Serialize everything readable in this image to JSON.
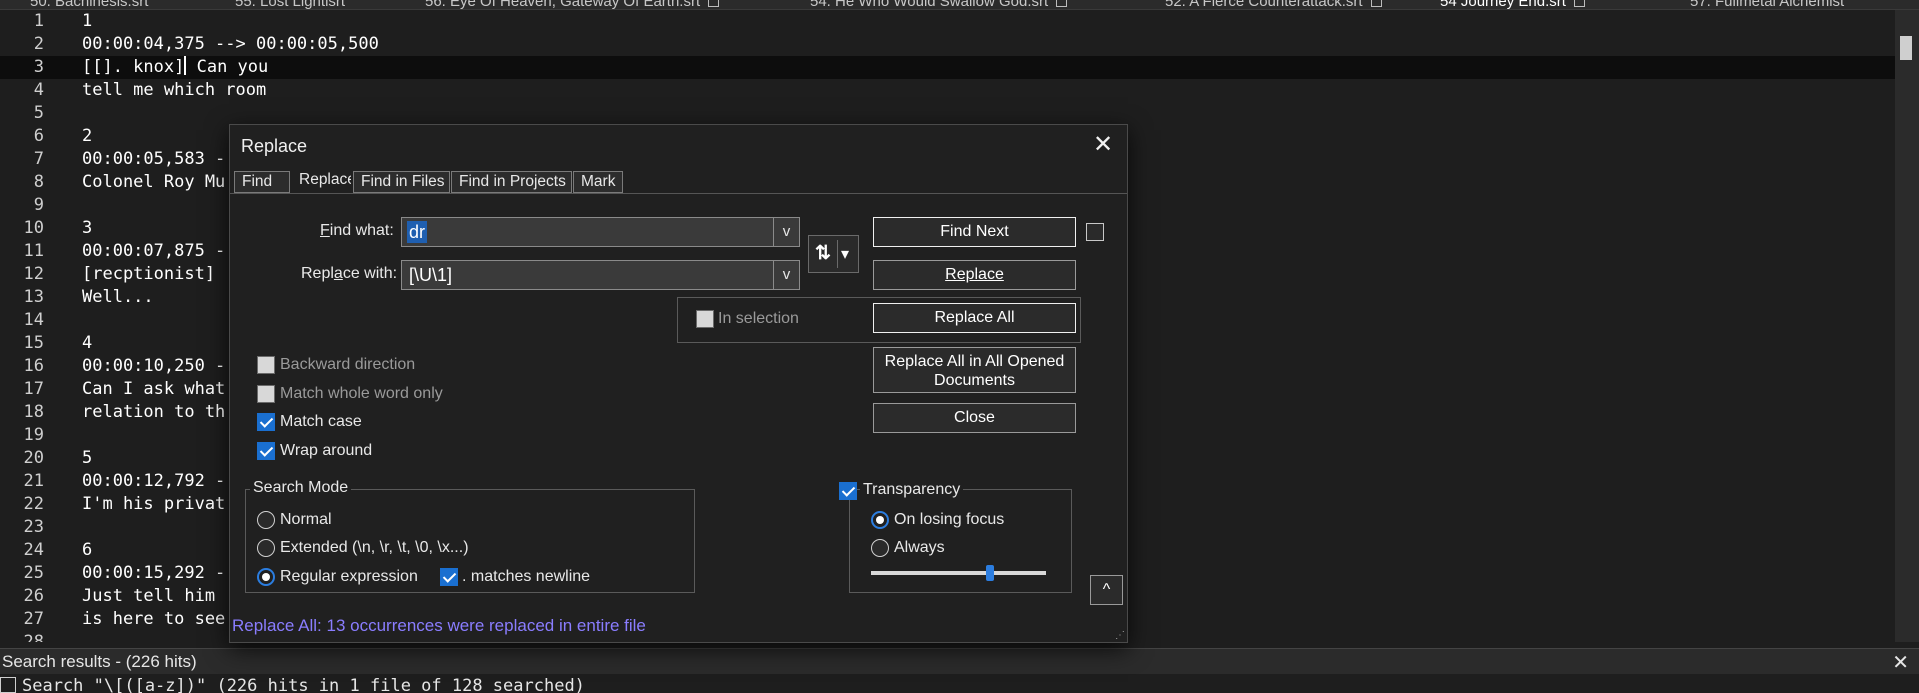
{
  "tabs": [
    {
      "label": "50. Bachinesis.srt",
      "active": false
    },
    {
      "label": "55. Lost Lightisrt",
      "active": false
    },
    {
      "label": "56. Eye Of Heaven, Gateway Of Earth.srt",
      "active": false
    },
    {
      "label": "54. He Who Would Swallow God.srt",
      "active": false
    },
    {
      "label": "52. A Fierce Counterattack.srt",
      "active": false
    },
    {
      "label": "54 Journey End.srt",
      "active": true
    },
    {
      "label": "57. Fullmetal Alchemist",
      "active": false
    }
  ],
  "editor": {
    "lines": [
      {
        "n": "1",
        "text": "1"
      },
      {
        "n": "2",
        "text": "00:00:04,375 --> 00:00:05,500"
      },
      {
        "n": "3",
        "text": "[[]. knox]",
        "after_caret": " Can you",
        "current": true
      },
      {
        "n": "4",
        "text": "tell me which room"
      },
      {
        "n": "5",
        "text": ""
      },
      {
        "n": "6",
        "text": "2"
      },
      {
        "n": "7",
        "text": "00:00:05,583 -"
      },
      {
        "n": "8",
        "text": "Colonel Roy Mu"
      },
      {
        "n": "9",
        "text": ""
      },
      {
        "n": "10",
        "text": "3"
      },
      {
        "n": "11",
        "text": "00:00:07,875 -"
      },
      {
        "n": "12",
        "text": "[recptionist]"
      },
      {
        "n": "13",
        "text": "Well..."
      },
      {
        "n": "14",
        "text": ""
      },
      {
        "n": "15",
        "text": "4"
      },
      {
        "n": "16",
        "text": "00:00:10,250 -"
      },
      {
        "n": "17",
        "text": "Can I ask what"
      },
      {
        "n": "18",
        "text": "relation to th"
      },
      {
        "n": "19",
        "text": ""
      },
      {
        "n": "20",
        "text": "5"
      },
      {
        "n": "21",
        "text": "00:00:12,792 -"
      },
      {
        "n": "22",
        "text": "I'm his privat"
      },
      {
        "n": "23",
        "text": ""
      },
      {
        "n": "24",
        "text": "6"
      },
      {
        "n": "25",
        "text": "00:00:15,292 -"
      },
      {
        "n": "26",
        "text": "Just tell him"
      },
      {
        "n": "27",
        "text": "is here to see"
      },
      {
        "n": "28",
        "text": ""
      }
    ]
  },
  "search_panel": {
    "title": "Search results - (226 hits)",
    "close_glyph": "✕",
    "first_line": "Search \"\\[([a-z])\" (226 hits in 1 file of 128 searched)"
  },
  "dialog": {
    "title": "Replace",
    "close_glyph": "✕",
    "tabs": [
      "Find",
      "Replace",
      "Find in Files",
      "Find in Projects",
      "Mark"
    ],
    "active_tab": "Replace",
    "find_what_label": "Find what:",
    "find_what_value": "dr",
    "replace_with_label": "Replace with:",
    "replace_with_value": "[\\U\\1]",
    "dropdown_glyph": "v",
    "swap_glyph": "⇅",
    "swap_dropdown_glyph": "▾",
    "buttons": {
      "find_next": "Find Next",
      "replace": "Replace",
      "replace_all": "Replace All",
      "replace_all_opened_1": "Replace All in All Opened",
      "replace_all_opened_2": "Documents",
      "close": "Close"
    },
    "in_selection_label": "In selection",
    "options": {
      "backward": "Backward direction",
      "whole_word": "Match whole word only",
      "match_case": "Match case",
      "wrap_around": "Wrap around"
    },
    "search_mode": {
      "title": "Search Mode",
      "normal": "Normal",
      "extended": "Extended (\\n, \\r, \\t, \\0, \\x...)",
      "regex": "Regular expression",
      "matches_newline": ". matches newline",
      "selected": "regex"
    },
    "transparency": {
      "title": "Transparency",
      "on_losing_focus": "On losing focus",
      "always": "Always",
      "selected": "on_losing_focus",
      "level": 0.68
    },
    "up_glyph": "^",
    "status": "Replace All: 13 occurrences were replaced in entire file",
    "colors": {
      "accent": "#1a6fd0",
      "status_text": "#8a7dff",
      "selection": "#1f5fb0"
    }
  }
}
